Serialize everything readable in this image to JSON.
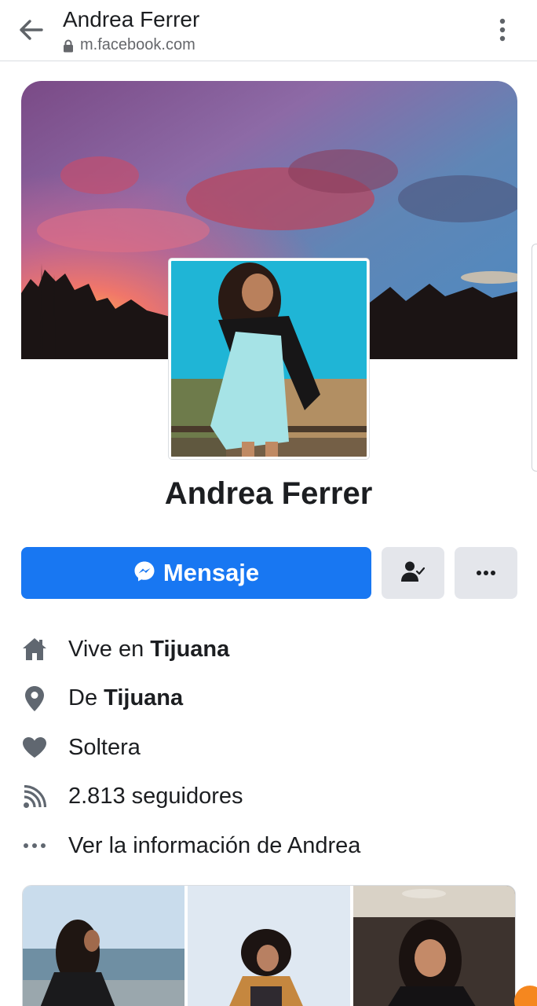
{
  "browser": {
    "title": "Andrea Ferrer",
    "url": "m.facebook.com",
    "icons": {
      "back": "arrow-left-icon",
      "lock": "lock-icon",
      "menu": "kebab-icon"
    }
  },
  "profile": {
    "name": "Andrea Ferrer"
  },
  "actions": {
    "message_label": "Mensaje",
    "message_icon": "messenger-icon",
    "friend_icon": "friend-check-icon",
    "more_icon": "more-icon"
  },
  "info": {
    "lives_prefix": "Vive en ",
    "lives_city": "Tijuana",
    "from_prefix": "De ",
    "from_city": "Tijuana",
    "relationship": "Soltera",
    "followers": "2.813 seguidores",
    "see_more": "Ver la información de Andrea"
  },
  "colors": {
    "accent": "#1877f2",
    "secondary_button": "#e4e6eb",
    "icon_gray": "#606770",
    "text": "#1c1e21"
  }
}
